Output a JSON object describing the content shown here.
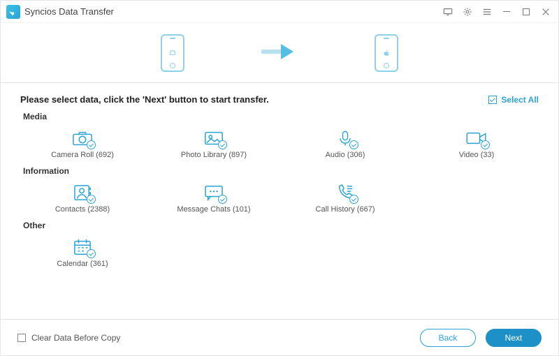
{
  "app": {
    "title": "Syncios Data Transfer"
  },
  "header": {
    "source_os": "android",
    "target_os": "ios"
  },
  "instruction": "Please select data, click the 'Next' button to start transfer.",
  "select_all": "Select All",
  "sections": {
    "media": {
      "title": "Media",
      "items": [
        {
          "label": "Camera Roll (692)"
        },
        {
          "label": "Photo Library (897)"
        },
        {
          "label": "Audio (306)"
        },
        {
          "label": "Video (33)"
        }
      ]
    },
    "information": {
      "title": "Information",
      "items": [
        {
          "label": "Contacts (2388)"
        },
        {
          "label": "Message Chats (101)"
        },
        {
          "label": "Call History (667)"
        }
      ]
    },
    "other": {
      "title": "Other",
      "items": [
        {
          "label": "Calendar (361)"
        }
      ]
    }
  },
  "footer": {
    "clear_label": "Clear Data Before Copy",
    "back_label": "Back",
    "next_label": "Next"
  }
}
